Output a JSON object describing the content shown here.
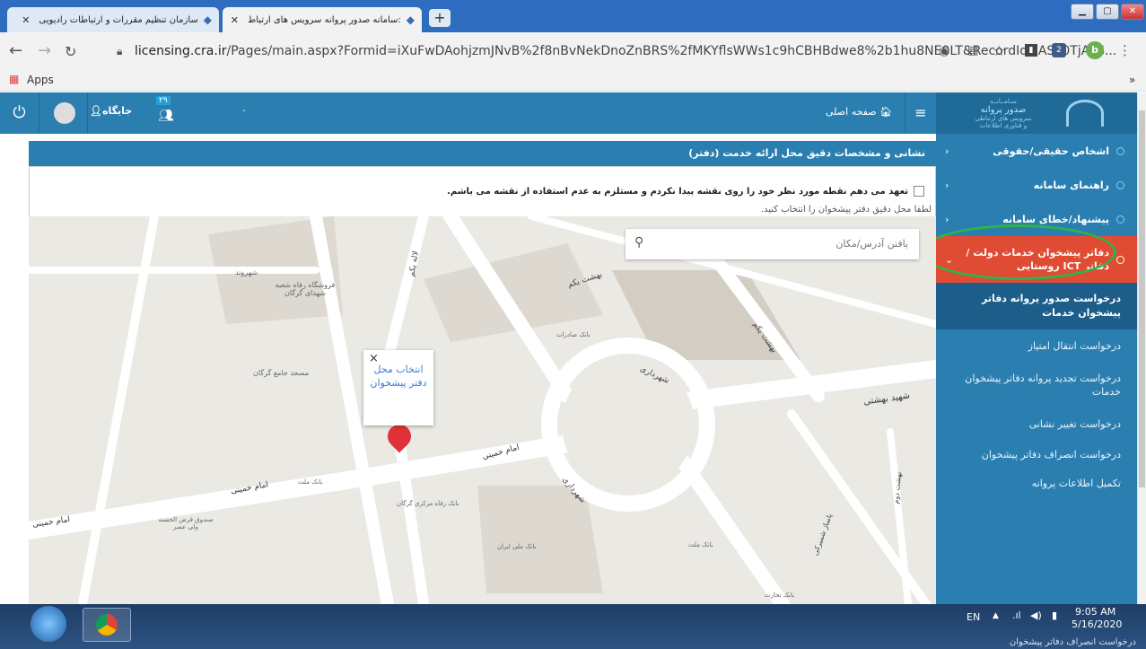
{
  "browser": {
    "tabs": [
      {
        "title": "سازمان تنظیم مقررات و ارتباطات رادیویی"
      },
      {
        "title": ":سامانه صدور پروانه سرویس های ارتباط"
      }
    ],
    "new_tab": "+",
    "url_host": "licensing.cra.ir",
    "url_path": "/Pages/main.aspx?Formid=iXuFwDAohjzmJNvB%2f8nBvNekDnoZnBRS%2fMKYflsWWs1c9hCBHBdwe8%2b1hu8NE0LT&RecordId=ASF0TjALS...",
    "bookmarks_apps": "Apps",
    "bookmarks_more": "»",
    "profile_initial": "b",
    "ext_count": "2"
  },
  "topbar": {
    "home_label": "صفحه اصلی",
    "dashboard_label": "جایگاه",
    "notification_count": "۲۹",
    "dot": "."
  },
  "sidebar": {
    "brand_line1": "سـامــانــه",
    "brand_line2": "صدور پروانه",
    "brand_line3": "سرویس های ارتباطی",
    "brand_line4": "و فناوری اطلاعات",
    "items": [
      {
        "label": "اشخاص حقیقی/حقوقی"
      },
      {
        "label": "راهنمای سامانه"
      },
      {
        "label": "پیشنهاد/خطای سامانه"
      },
      {
        "label": "دفاتر پیشخوان خدمات دولت / دفاتر ICT روستایی"
      }
    ],
    "subitems": [
      {
        "label": "درخواست صدور پروانه دفاتر پیشخوان خدمات"
      },
      {
        "label": "درخواست انتقال امتیاز"
      },
      {
        "label": "درخواست تجدید پروانه دفاتر پیشخوان خدمات"
      },
      {
        "label": "درخواست تغییر نشانی"
      },
      {
        "label": "درخواست انصراف دفاتر پیشخوان"
      },
      {
        "label": "تکمیل اطلاعات پروانه"
      }
    ],
    "chev": "‹",
    "bottom_peek": "درخواست انصراف دفاتر پیشخوان"
  },
  "panel": {
    "title": "نشانی و مشخصات دقیق محل ارائه خدمت (دفتر)",
    "checkbox_label": "تعهد می دهم نقطه مورد نظر خود را روی نقشه پیدا نکردم و مستلزم به عدم استفاده از نقشه می باشم.",
    "hint": "لطفا محل دقیق دفتر پیشخوان را انتخاب کنید."
  },
  "map": {
    "search_placeholder": "یافتن آدرس/مکان",
    "popup_text": "انتخاب محل دفتر پیشخوان",
    "popup_close": "×",
    "labels": {
      "shahrvand": "شهروند",
      "refah_store": "فروشگاه رفاه شعبه شهدای گرگان",
      "lale": "لاله یکم",
      "behesht1": "بهشت یکم",
      "behesht1b": "بهشت یکم",
      "bank_saderat": "بانک صادرات",
      "masjed": "مسجد جامع گرگان",
      "shahrdari": "شهرداری",
      "shahrdari2": "شهرداری",
      "shahid_beheshti": "شهید بهشتی",
      "imam1": "امام خمینی",
      "imam2": "امام خمینی",
      "imam3": "امام خمینی",
      "bank_mellat": "بانک ملت",
      "bank_refah": "بانک رفاه مرکزی گرگان",
      "sandogh": "صندوق قرض الحسنه ولی عصر",
      "bank_melli": "بانک ملی ایران",
      "bank_mellat2": "بانک ملت",
      "behesht2": "بهشت دوم",
      "parking": "پاساژ شمیرکی",
      "bank_tejarat": "بانک تجارت"
    }
  },
  "taskbar": {
    "lang": "EN",
    "time": "9:05 AM",
    "date": "5/16/2020"
  }
}
